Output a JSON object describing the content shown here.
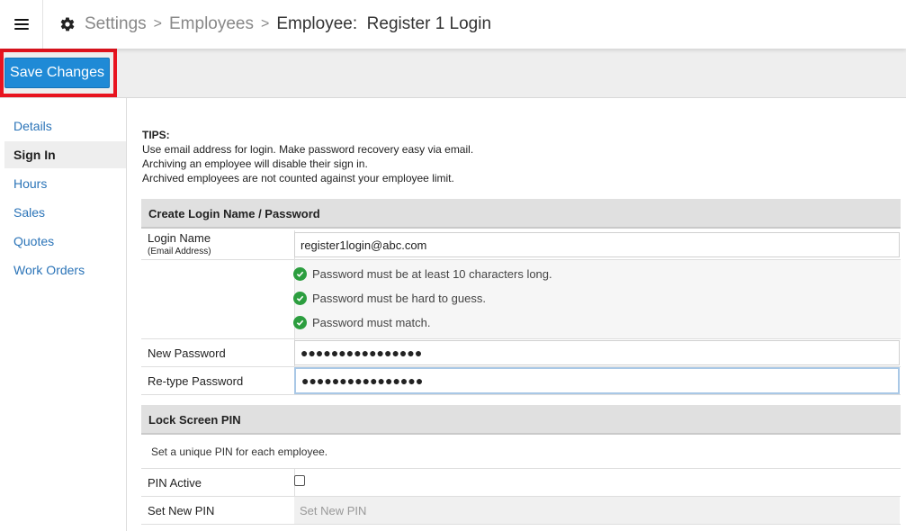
{
  "header": {
    "breadcrumb": {
      "settings": "Settings",
      "employees": "Employees",
      "current": "Employee:  Register 1 Login",
      "separator": ">"
    },
    "icons": {
      "menu": "hamburger-icon",
      "settings": "gear-icon"
    }
  },
  "toolbar": {
    "save_label": "Save Changes",
    "save_color": "#1f8ad6",
    "highlight_color": "#e8141f"
  },
  "sidebar": {
    "items": [
      {
        "label": "Details",
        "active": false
      },
      {
        "label": "Sign In",
        "active": true
      },
      {
        "label": "Hours",
        "active": false
      },
      {
        "label": "Sales",
        "active": false
      },
      {
        "label": "Quotes",
        "active": false
      },
      {
        "label": "Work Orders",
        "active": false
      }
    ]
  },
  "tips": {
    "title": "TIPS:",
    "lines": [
      "Use email address for login. Make password recovery easy via email.",
      "Archiving an employee will disable their sign in.",
      "Archived employees are not counted against your employee limit."
    ]
  },
  "login_section": {
    "title": "Create Login Name / Password",
    "login_name_label": "Login Name",
    "login_name_sublabel": "(Email Address)",
    "login_name_value": "register1login@abc.com",
    "rules": [
      "Password must be at least 10 characters long.",
      "Password must be hard to guess.",
      "Password must match."
    ],
    "rule_check_color": "#2c9e3f",
    "new_password_label": "New Password",
    "new_password_value": "●●●●●●●●●●●●●●●●",
    "retype_password_label": "Re-type Password",
    "retype_password_value": "●●●●●●●●●●●●●●●●"
  },
  "pin_section": {
    "title": "Lock Screen PIN",
    "note": "Set a unique PIN for each employee.",
    "pin_active_label": "PIN Active",
    "pin_active_checked": false,
    "set_pin_label": "Set New PIN",
    "set_pin_placeholder": "Set New PIN"
  }
}
